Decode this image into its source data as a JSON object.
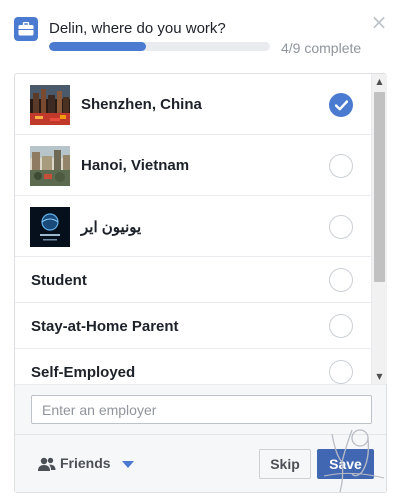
{
  "header": {
    "title": "Delin, where do you work?",
    "progress_text": "4/9 complete",
    "progress_fraction": 0.44,
    "briefcase_icon": "briefcase-icon",
    "close_icon": "close-icon",
    "close_glyph": "×"
  },
  "options": [
    {
      "label": "Shenzhen, China",
      "thumbnail": "city-night-photo",
      "selected": true
    },
    {
      "label": "Hanoi, Vietnam",
      "thumbnail": "city-street-photo",
      "selected": false
    },
    {
      "label": "يونيون اير",
      "thumbnail": "airline-logo",
      "selected": false
    },
    {
      "label": "Student",
      "selected": false
    },
    {
      "label": "Stay-at-Home Parent",
      "selected": false
    },
    {
      "label": "Self-Employed",
      "selected": false
    }
  ],
  "scrollbar": {
    "up_glyph": "▲",
    "down_glyph": "▼"
  },
  "employer_input": {
    "placeholder": "Enter an employer",
    "value": ""
  },
  "footer": {
    "audience_label": "Friends",
    "audience_icon": "friends-icon",
    "skip_label": "Skip",
    "save_label": "Save"
  },
  "colors": {
    "accent": "#4b7bd0",
    "save_button": "#4267b2",
    "panel_border": "#dddfe2",
    "muted_text": "#90949c"
  }
}
